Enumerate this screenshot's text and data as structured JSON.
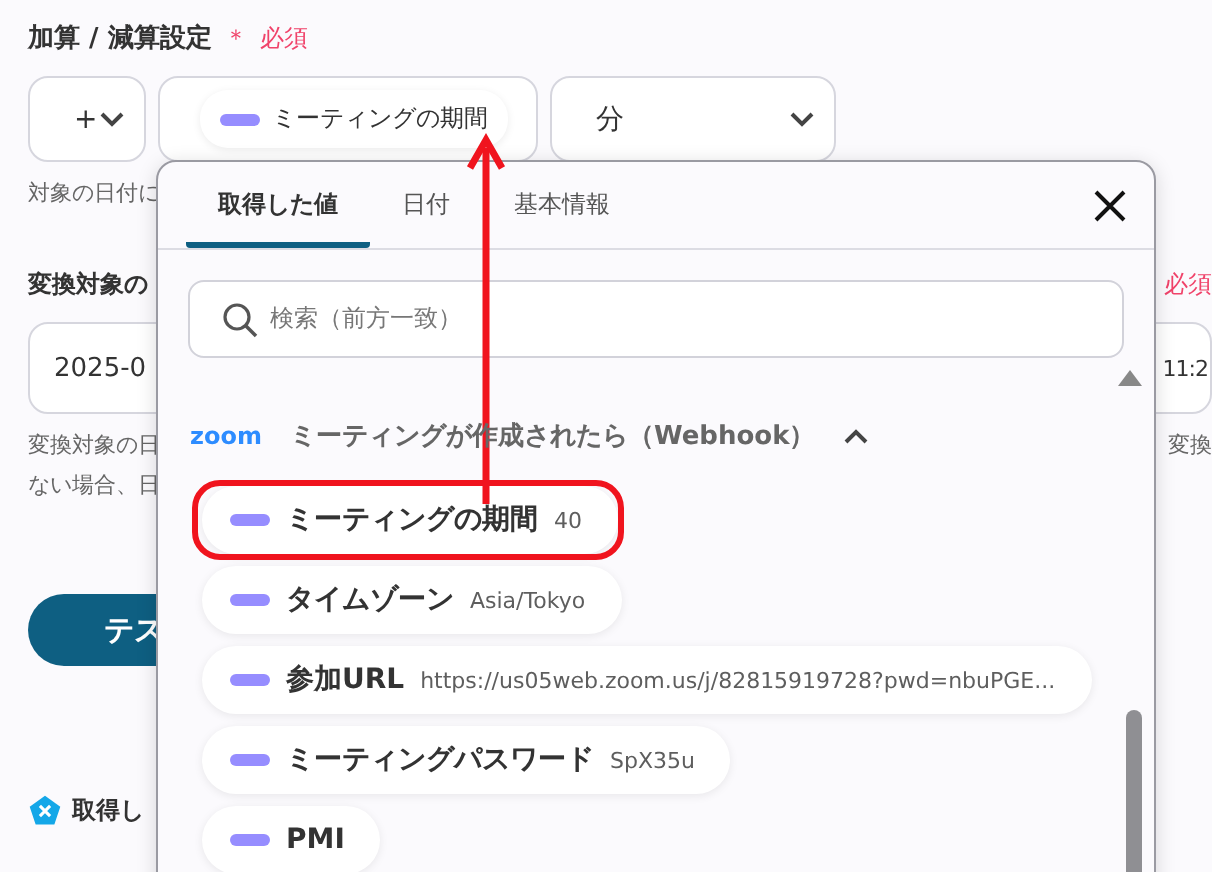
{
  "section": {
    "title": "加算 / 減算設定",
    "required_mark": "＊",
    "required": "必須"
  },
  "operator_select": {
    "value": "+"
  },
  "amount_field": {
    "token": "ミーティングの期間"
  },
  "unit_select": {
    "value": "分"
  },
  "hint": "対象の日付に",
  "target": {
    "title": "変換対象の",
    "required": "必須",
    "value_left": "2025-0",
    "value_right": "11:2",
    "hint_right": "変換",
    "hint_left": [
      "変換対象の日",
      "ない場合、日"
    ]
  },
  "test_button": "テス",
  "output_heading": "取得し",
  "picker": {
    "tabs": [
      {
        "label": "取得した値",
        "selected": true
      },
      {
        "label": "日付",
        "selected": false
      },
      {
        "label": "基本情報",
        "selected": false
      }
    ],
    "search": {
      "placeholder": "検索（前方一致）"
    },
    "group": {
      "logo": "zoom",
      "title": "ミーティングが作成されたら（Webhook）",
      "expanded": true,
      "items": [
        {
          "label": "ミーティングの期間",
          "value": "40",
          "highlighted": true
        },
        {
          "label": "タイムゾーン",
          "value": "Asia/Tokyo",
          "highlighted": false
        },
        {
          "label": "参加URL",
          "value": "https://us05web.zoom.us/j/82815919728?pwd=nbuPGE...",
          "highlighted": false
        },
        {
          "label": "ミーティングパスワード",
          "value": "SpX35u",
          "highlighted": false
        },
        {
          "label": "PMI",
          "highlighted": false
        }
      ]
    }
  }
}
